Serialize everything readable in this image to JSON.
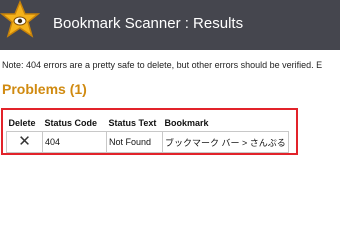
{
  "header": {
    "title": "Bookmark Scanner : Results",
    "logo_icon": "star-eye-logo-icon",
    "background_color": "#45464e"
  },
  "note": "Note: 404 errors are a pretty safe to delete, but other errors should be verified. E",
  "problems": {
    "heading": "Problems (1)",
    "heading_color": "#d08a10",
    "frame_color": "#e2232a",
    "columns": [
      "Delete",
      "Status Code",
      "Status Text",
      "Bookmark"
    ],
    "rows": [
      {
        "delete_icon": "close-icon",
        "delete_glyph": "✕",
        "status_code": "404",
        "status_text": "Not Found",
        "bookmark": "ブックマーク バー > さんぷる"
      }
    ]
  }
}
